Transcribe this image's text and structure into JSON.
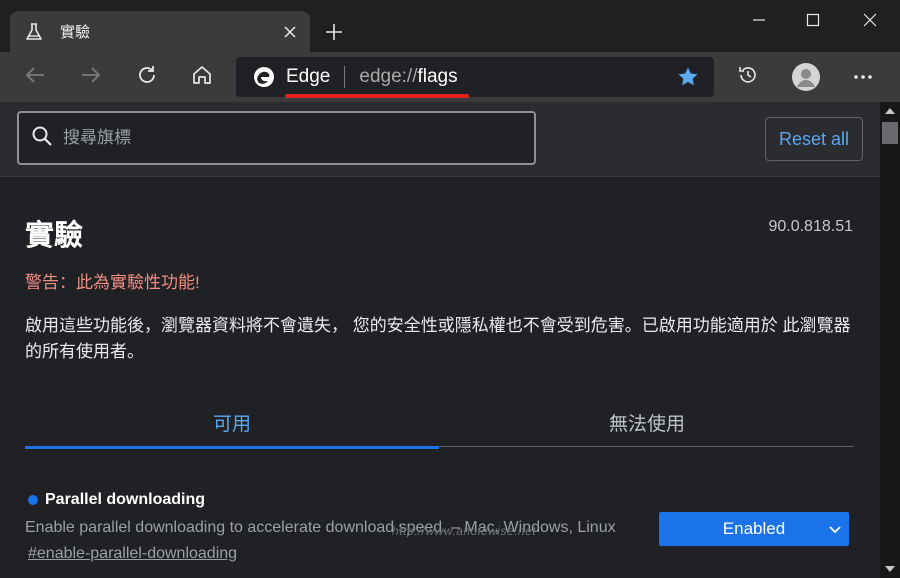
{
  "browser": {
    "tab_title": "實驗",
    "omnibox_site": "Edge",
    "omnibox_url_prefix": "edge://",
    "omnibox_url_main": "flags",
    "icons": {
      "tab": "flask-icon",
      "back": "back-arrow-icon",
      "forward": "forward-arrow-icon",
      "refresh": "refresh-icon",
      "home": "home-icon",
      "favorite": "star-icon",
      "history": "history-icon",
      "profile": "avatar",
      "menu": "more-icon"
    },
    "colors": {
      "accent": "#1a73e8",
      "warning": "#f28b82",
      "highlight_underline": "#e0211d"
    }
  },
  "search": {
    "placeholder": "搜尋旗標",
    "reset_label": "Reset all"
  },
  "header": {
    "title": "實驗",
    "version": "90.0.818.51",
    "warning": "警告：此為實驗性功能!",
    "description": "啟用這些功能後，瀏覽器資料將不會遺失， 您的安全性或隱私權也不會受到危害。已啟用功能適用於 此瀏覽器的所有使用者。"
  },
  "tabs": [
    {
      "label": "可用",
      "active": true
    },
    {
      "label": "無法使用",
      "active": false
    }
  ],
  "flags": [
    {
      "name": "Parallel downloading",
      "description": "Enable parallel downloading to accelerate download speed. – Mac, Windows, Linux",
      "link": "#enable-parallel-downloading",
      "state": "Enabled"
    }
  ],
  "watermark": "http://www.aholewise.net"
}
